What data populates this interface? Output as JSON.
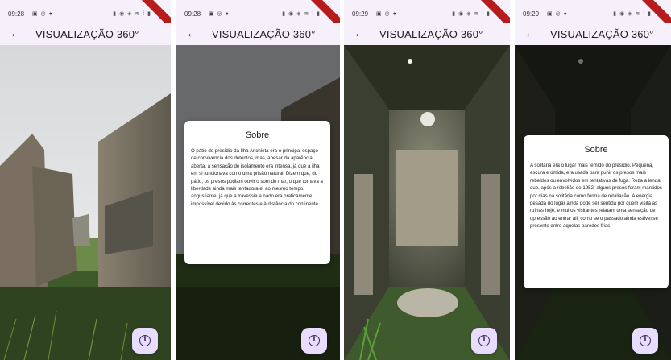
{
  "screens": [
    {
      "status": {
        "time": "09:28",
        "app_icons": "▣ ◎ ●"
      },
      "title": "VISUALIZAÇÃO 360°",
      "scene": "ruined-courtyard-walls"
    },
    {
      "status": {
        "time": "09:28",
        "app_icons": "▣ ◎ ●"
      },
      "title": "VISUALIZAÇÃO 360°",
      "scene": "ruined-courtyard-dimmed",
      "dialog": {
        "title": "Sobre",
        "text": "O pátio do presídio da Ilha Anchieta era o principal espaço de convivência dos detentos, mas, apesar da aparência aberta, a sensação de isolamento era intensa, já que a ilha em si funcionava como uma prisão natural. Dizem que, do pátio, os presos podiam ouvir o som do mar, o que tornava a liberdade ainda mais tentadora e, ao mesmo tempo, angustiante, já que a travessia a nado era praticamente impossível devido às correntes e à distância do continente."
      }
    },
    {
      "status": {
        "time": "09:29",
        "app_icons": "▣ ◎ ●"
      },
      "title": "VISUALIZAÇÃO 360°",
      "scene": "solitary-cell-corridor"
    },
    {
      "status": {
        "time": "09:29",
        "app_icons": "▣ ◎ ●"
      },
      "title": "VISUALIZAÇÃO 360°",
      "scene": "solitary-cell-dimmed",
      "dialog": {
        "title": "Sobre",
        "text": "A solitária era o lugar mais temido do presídio. Pequena, escura e úmida, era usada para punir os presos mais rebeldes ou envolvidos em tentativas de fuga. Reza a lenda que, após a rebelião de 1952, alguns presos foram mantidos por dias na solitária como forma de retaliação. A energia pesada do lugar ainda pode ser sentida por quem visita as ruínas hoje, e muitos visitantes relatam uma sensação de opressão ao entrar ali, como se o passado ainda estivesse presente entre aquelas paredes frias."
      }
    }
  ],
  "icons": {
    "back": "arrow-left-icon",
    "info": "info-icon"
  },
  "colors": {
    "appbar_bg": "#f6f0fa",
    "fab_bg": "#e9ddff",
    "debug_banner": "#b71c1c"
  }
}
